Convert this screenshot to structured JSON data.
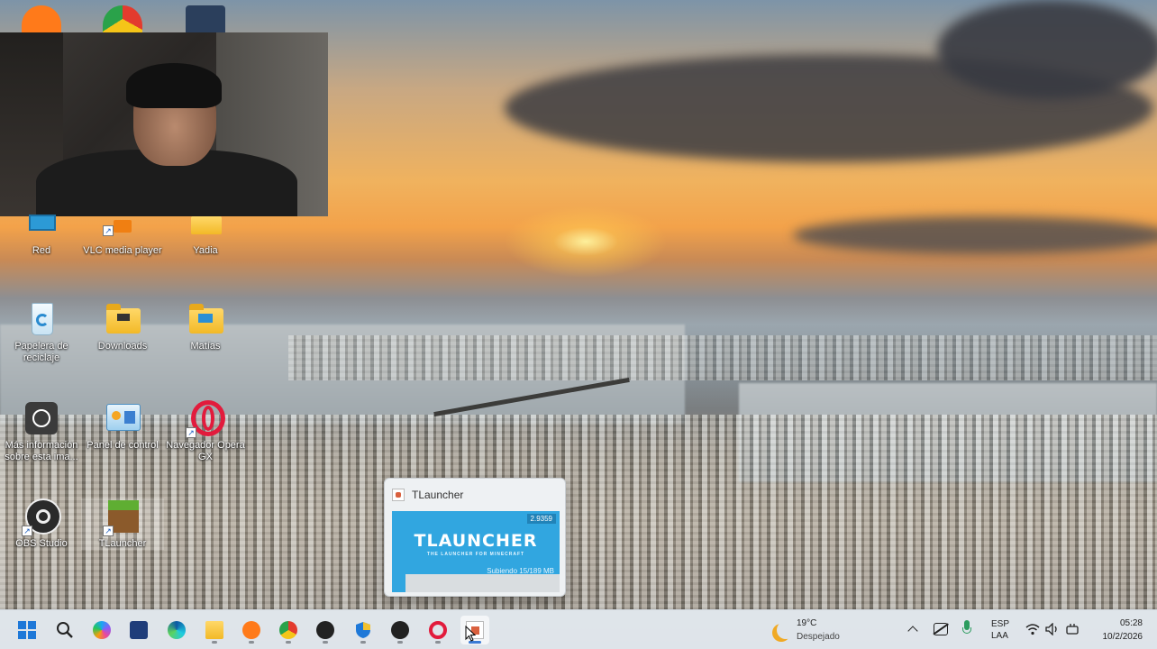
{
  "desktop_icons": [
    {
      "label": "Red",
      "icon": "network-icon"
    },
    {
      "label": "VLC media player",
      "icon": "vlc-icon"
    },
    {
      "label": "Yadia",
      "icon": "folder-icon"
    },
    {
      "label": "Papelera de reciclaje",
      "icon": "recycle-bin-icon"
    },
    {
      "label": "Downloads",
      "icon": "folder-icon"
    },
    {
      "label": "Matías",
      "icon": "folder-icon"
    },
    {
      "label": "Más información sobre esta ima...",
      "icon": "info-camera-icon"
    },
    {
      "label": "Panel de control",
      "icon": "control-panel-icon"
    },
    {
      "label": "Navegador Opera GX",
      "icon": "opera-gx-icon"
    },
    {
      "label": "OBS Studio",
      "icon": "obs-icon"
    },
    {
      "label": "TLauncher",
      "icon": "minecraft-grass-icon"
    }
  ],
  "tlauncher_popup": {
    "title": "TLauncher",
    "version": "2.9359",
    "logo": "TLAUNCHER",
    "tagline": "THE LAUNCHER FOR MINECRAFT",
    "status": "Subiendo 15/189 MB",
    "progress": 0.08
  },
  "taskbar": {
    "apps": [
      "start-icon",
      "search-icon",
      "copilot-icon",
      "store-icon",
      "edge-icon",
      "file-explorer-icon",
      "avast-icon",
      "chrome-icon",
      "obs-icon",
      "security-shield-icon",
      "obs-icon",
      "opera-gx-icon",
      "tlauncher-icon"
    ],
    "weather_temp": "19°C",
    "weather_desc": "Despejado",
    "lang_line1": "ESP",
    "lang_line2": "LAA",
    "time": "05:28",
    "date": "10/2/2026"
  },
  "colors": {
    "accent": "#31a6e0",
    "taskbar": "#e2e8ee"
  }
}
